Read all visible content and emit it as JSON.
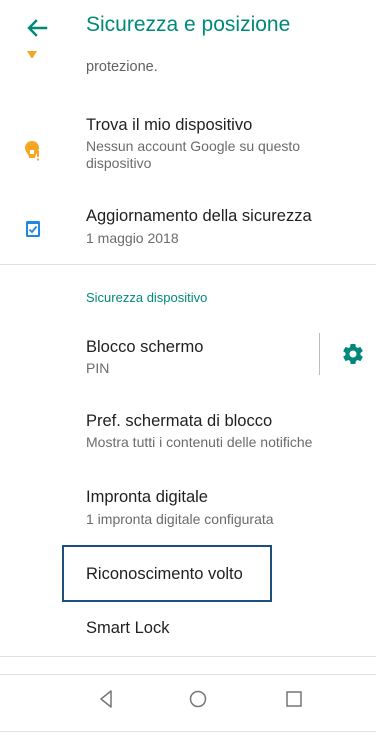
{
  "header": {
    "title": "Sicurezza e posizione",
    "back_icon": "arrow-left-icon"
  },
  "cut_item": {
    "subtitle": "protezione."
  },
  "items": [
    {
      "title": "Trova il mio dispositivo",
      "subtitle": "Nessun account Google su questo dispositivo",
      "icon": "find-device-icon"
    },
    {
      "title": "Aggiornamento della sicurezza",
      "subtitle": "1 maggio 2018",
      "icon": "security-update-icon"
    }
  ],
  "section": {
    "header": "Sicurezza dispositivo",
    "items": [
      {
        "title": "Blocco schermo",
        "subtitle": "PIN",
        "settings_icon": "gear-icon"
      },
      {
        "title": "Pref. schermata di blocco",
        "subtitle": "Mostra tutti i contenuti delle notifiche"
      },
      {
        "title": "Impronta digitale",
        "subtitle": "1 impronta digitale configurata"
      },
      {
        "title": "Riconoscimento volto"
      },
      {
        "title": "Smart Lock"
      }
    ]
  },
  "navbar": {
    "back": "back-triangle-icon",
    "home": "home-circle-icon",
    "recents": "recents-square-icon"
  },
  "colors": {
    "accent": "#00897b",
    "icon_orange": "#f5a623",
    "icon_blue": "#1e88e5",
    "focus_outline": "#1e4f7a"
  }
}
